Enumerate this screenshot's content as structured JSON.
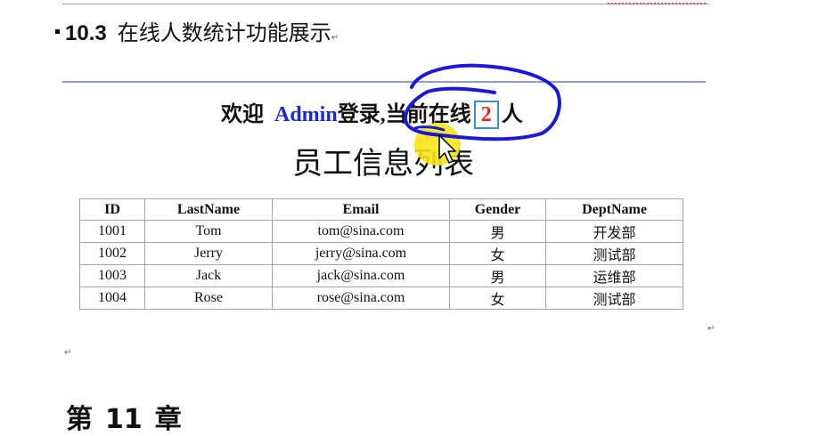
{
  "heading": {
    "number": "10.3",
    "title": "在线人数统计功能展示",
    "para_mark": "↵"
  },
  "welcome": {
    "prefix": "欢迎",
    "user": "Admin",
    "middle": "登录,当前在线",
    "count": "2",
    "suffix": "人"
  },
  "page_title": "员工信息列表",
  "table": {
    "headers": [
      "ID",
      "LastName",
      "Email",
      "Gender",
      "DeptName"
    ],
    "rows": [
      [
        "1001",
        "Tom",
        "tom@sina.com",
        "男",
        "开发部"
      ],
      [
        "1002",
        "Jerry",
        "jerry@sina.com",
        "女",
        "测试部"
      ],
      [
        "1003",
        "Jack",
        "jack@sina.com",
        "男",
        "运维部"
      ],
      [
        "1004",
        "Rose",
        "rose@sina.com",
        "女",
        "测试部"
      ]
    ]
  },
  "para_marks": [
    "↵",
    "↵"
  ],
  "chapter": {
    "prefix": "第",
    "number": "11",
    "suffix": "章"
  },
  "colors": {
    "user_name": "#1a2ad1",
    "count": "#e0281e",
    "count_border": "#3a8fd9",
    "annotation": "#1a1ad6",
    "highlight": "#f7e31a"
  },
  "icons": [
    "pen-annotation-icon",
    "mouse-cursor-icon"
  ]
}
